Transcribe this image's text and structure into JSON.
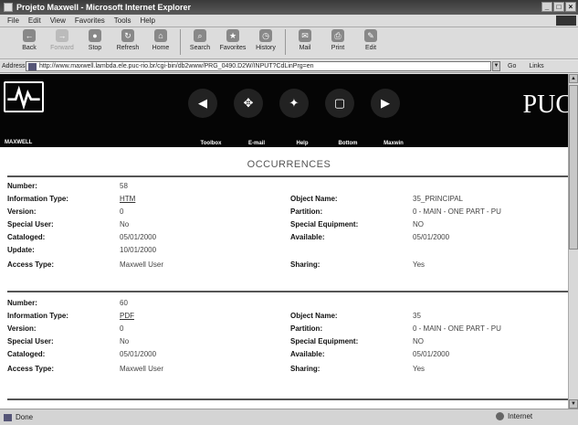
{
  "window": {
    "title": "Projeto Maxwell - Microsoft Internet Explorer"
  },
  "menu": [
    "File",
    "Edit",
    "View",
    "Favorites",
    "Tools",
    "Help"
  ],
  "toolbar": {
    "buttons": [
      {
        "label": "Back",
        "icon": "back-arrow-icon"
      },
      {
        "label": "Forward",
        "icon": "forward-arrow-icon"
      },
      {
        "label": "Stop",
        "icon": "stop-icon"
      },
      {
        "label": "Refresh",
        "icon": "refresh-icon"
      },
      {
        "label": "Home",
        "icon": "home-icon"
      },
      {
        "label": "Search",
        "icon": "search-icon"
      },
      {
        "label": "Favorites",
        "icon": "favorites-icon"
      },
      {
        "label": "History",
        "icon": "history-icon"
      },
      {
        "label": "Mail",
        "icon": "mail-icon"
      },
      {
        "label": "Print",
        "icon": "print-icon"
      },
      {
        "label": "Edit",
        "icon": "edit-icon"
      }
    ]
  },
  "address": {
    "label": "Address",
    "url": "http://www.maxwell.lambda.ele.puc-rio.br/cgi-bin/db2www/PRG_0490.D2W/INPUT?CdLinPrg=en",
    "go": "Go",
    "links": "Links"
  },
  "site": {
    "logo_label": "MAXWELL",
    "brand": "PUC",
    "nav": [
      "Toolbox",
      "E-mail",
      "Help",
      "Bottom",
      "Maxwin"
    ],
    "page_title": "OCCURRENCES"
  },
  "records": [
    {
      "number_label": "Number:",
      "number": "58",
      "type_label": "Information Type:",
      "type": "HTM",
      "version_label": "Version:",
      "version": "0",
      "special_user_label": "Special User:",
      "special_user": "No",
      "cataloged_label": "Cataloged:",
      "cataloged": "05/01/2000",
      "update_label": "Update:",
      "update": "10/01/2000",
      "access_label": "Access Type:",
      "access": "Maxwell User",
      "object_label": "Object Name:",
      "object": "35_PRINCIPAL",
      "partition_label": "Partition:",
      "partition": "0 - MAIN - ONE PART - PU",
      "equipment_label": "Special Equipment:",
      "equipment": "NO",
      "available_label": "Available:",
      "available": "05/01/2000",
      "sharing_label": "Sharing:",
      "sharing": "Yes"
    },
    {
      "number_label": "Number:",
      "number": "60",
      "type_label": "Information Type:",
      "type": "PDF",
      "version_label": "Version:",
      "version": "0",
      "special_user_label": "Special User:",
      "special_user": "No",
      "cataloged_label": "Cataloged:",
      "cataloged": "05/01/2000",
      "access_label": "Access Type:",
      "access": "Maxwell User",
      "object_label": "Object Name:",
      "object": "35",
      "partition_label": "Partition:",
      "partition": "0 - MAIN - ONE PART - PU",
      "equipment_label": "Special Equipment:",
      "equipment": "NO",
      "available_label": "Available:",
      "available": "05/01/2000",
      "sharing_label": "Sharing:",
      "sharing": "Yes"
    }
  ],
  "status": {
    "text": "Done",
    "zone": "Internet"
  }
}
